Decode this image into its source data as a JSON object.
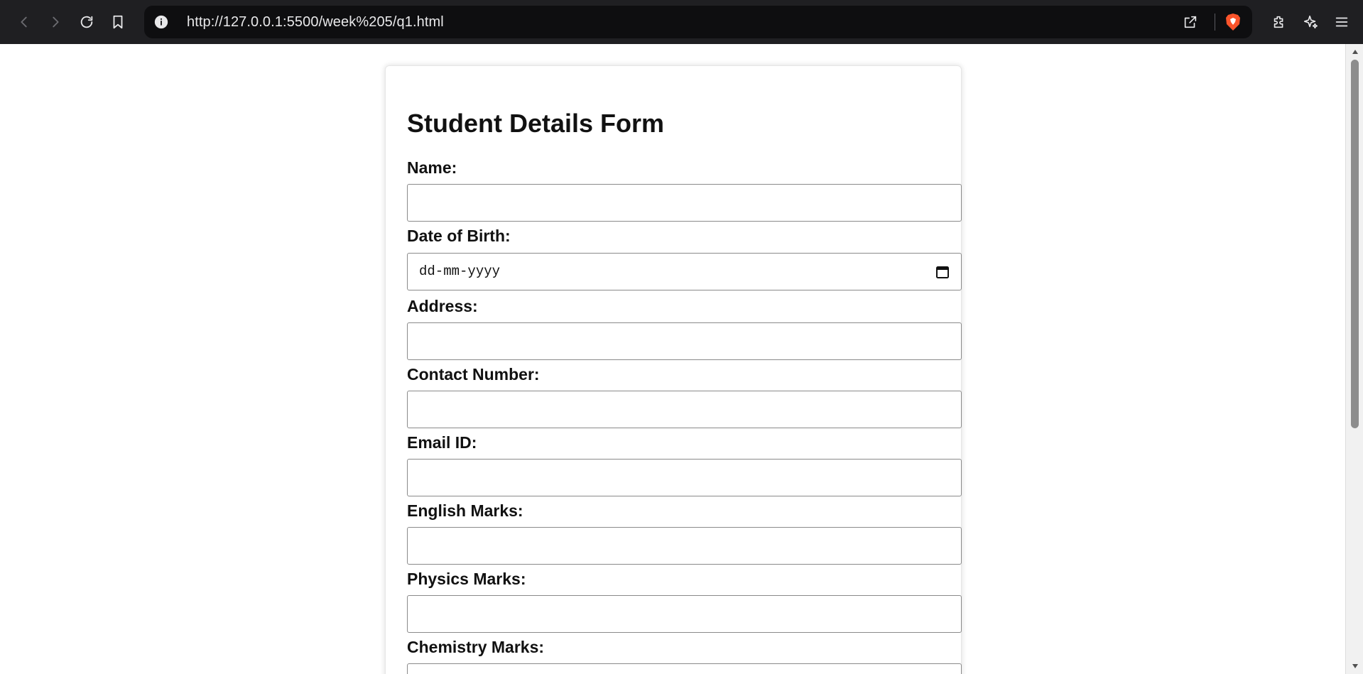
{
  "browser": {
    "url": "http://127.0.0.1:5500/week%205/q1.html",
    "icons": [
      "back-icon",
      "forward-icon",
      "reload-icon",
      "bookmark-icon",
      "site-info-icon",
      "share-icon",
      "brave-shields-icon",
      "extensions-icon",
      "leo-ai-icon",
      "menu-icon"
    ]
  },
  "form": {
    "title": "Student Details Form",
    "fields": [
      {
        "label": "Name:",
        "type": "text",
        "value": ""
      },
      {
        "label": "Date of Birth:",
        "type": "date",
        "placeholder": "dd-mm-yyyy",
        "value": ""
      },
      {
        "label": "Address:",
        "type": "text",
        "value": ""
      },
      {
        "label": "Contact Number:",
        "type": "text",
        "value": ""
      },
      {
        "label": "Email ID:",
        "type": "text",
        "value": ""
      },
      {
        "label": "English Marks:",
        "type": "text",
        "value": ""
      },
      {
        "label": "Physics Marks:",
        "type": "text",
        "value": ""
      },
      {
        "label": "Chemistry Marks:",
        "type": "text",
        "value": ""
      }
    ]
  },
  "colors": {
    "toolbar_bg": "#1f1f22",
    "urlbar_bg": "#0e0e10",
    "brave_orange": "#fb542b"
  }
}
